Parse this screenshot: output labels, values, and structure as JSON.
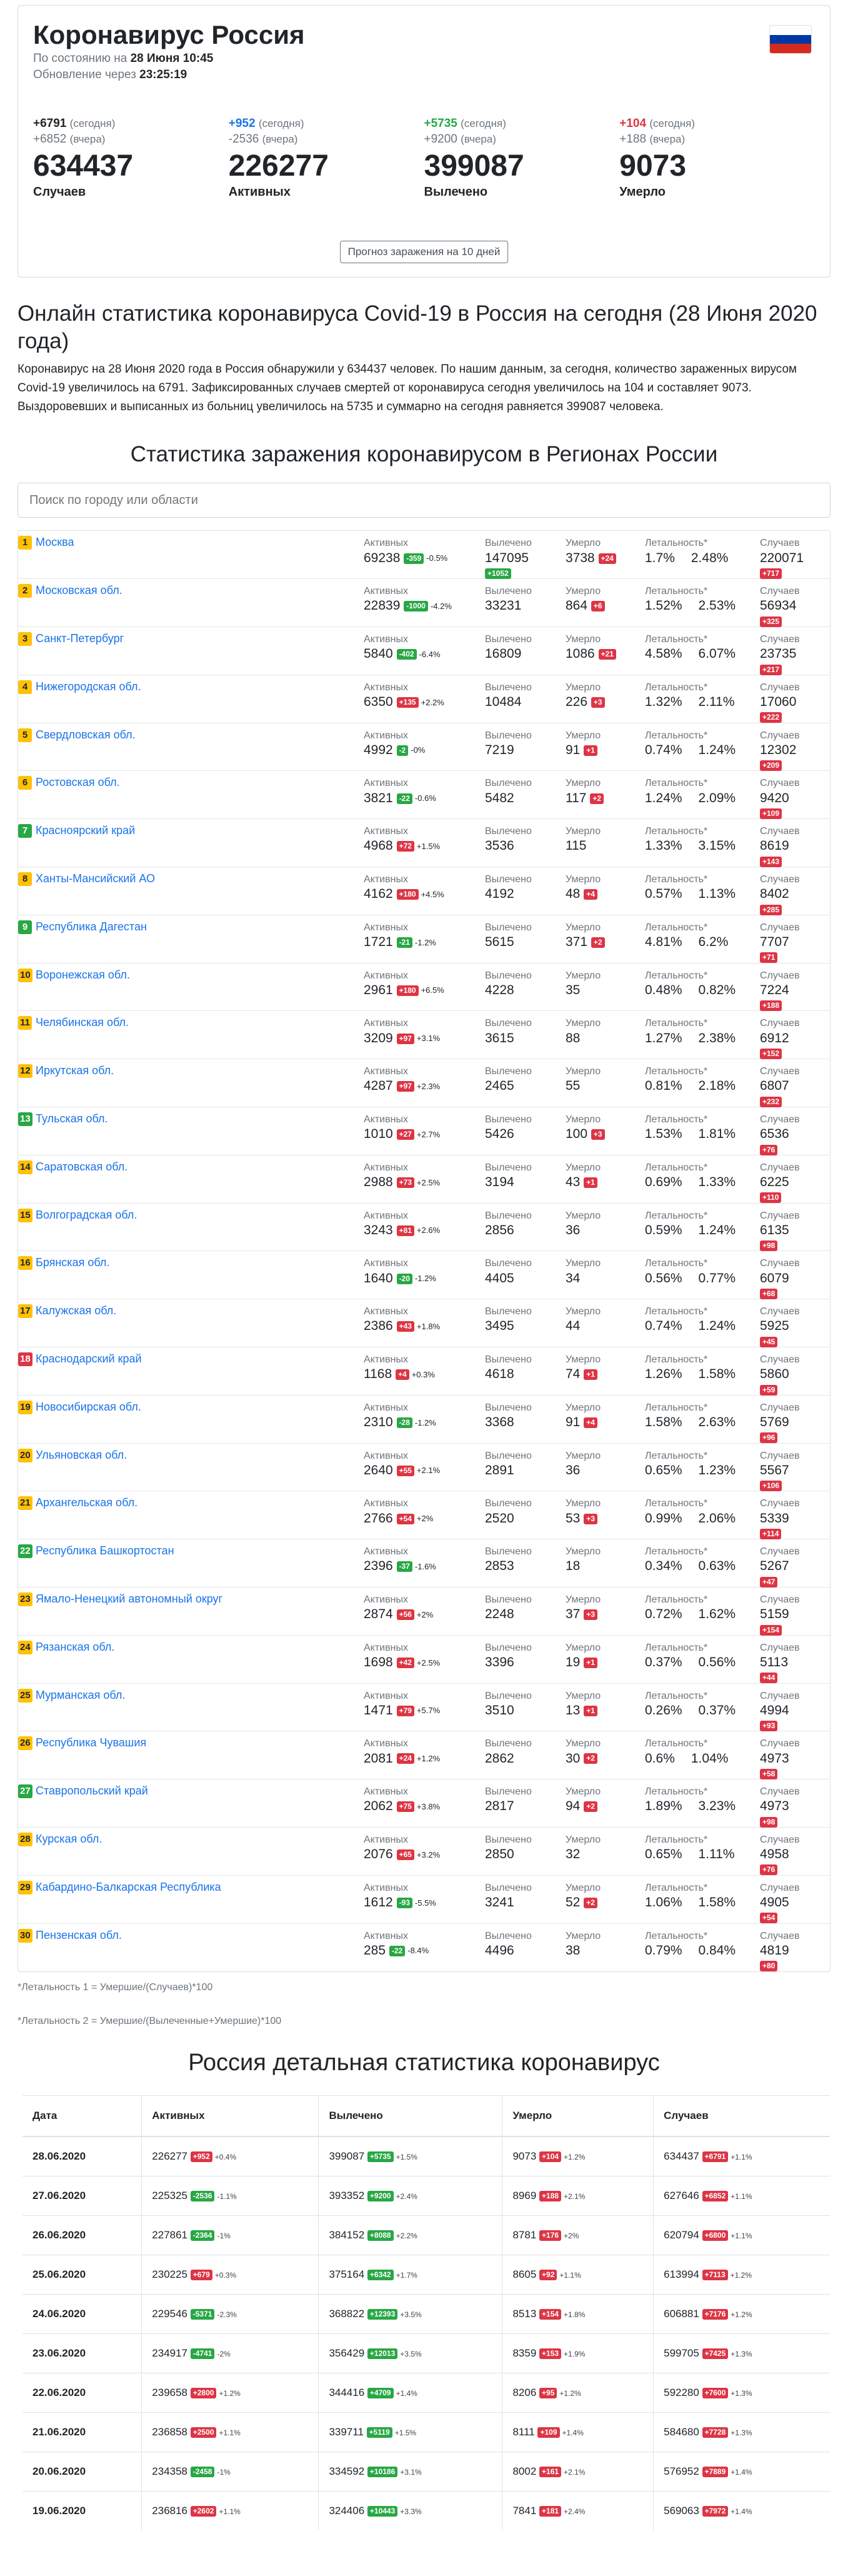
{
  "header": {
    "title": "Коронавирус Россия",
    "as_of_label": "По состоянию на",
    "as_of": "28 Июня 10:45",
    "refresh_label": "Обновление через",
    "refresh_in": "23:25:19"
  },
  "colors": {
    "flag": [
      "#ffffff",
      "#0039a6",
      "#d52b1e"
    ],
    "active": "#1a73e8",
    "recovered": "#28a745",
    "deaths": "#dc3545"
  },
  "stats": [
    {
      "key": "cases",
      "today": "+6791",
      "today_label": "(сегодня)",
      "yesterday": "+6852",
      "yesterday_label": "(вчера)",
      "total": "634437",
      "label": "Случаев",
      "color": "#212529"
    },
    {
      "key": "active",
      "today": "+952",
      "today_label": "(сегодня)",
      "yesterday": "-2536",
      "yesterday_label": "(вчера)",
      "total": "226277",
      "label": "Активных",
      "color": "#1a73e8"
    },
    {
      "key": "recovered",
      "today": "+5735",
      "today_label": "(сегодня)",
      "yesterday": "+9200",
      "yesterday_label": "(вчера)",
      "total": "399087",
      "label": "Вылечено",
      "color": "#28a745"
    },
    {
      "key": "deaths",
      "today": "+104",
      "today_label": "(сегодня)",
      "yesterday": "+188",
      "yesterday_label": "(вчера)",
      "total": "9073",
      "label": "Умерло",
      "color": "#dc3545"
    }
  ],
  "forecast_button": "Прогноз заражения на 10 дней",
  "main_heading": "Онлайн статистика коронавируса Covid-19 в Россия на сегодня (28 Июня 2020 года)",
  "main_text": "Коронавирус на 28 Июня 2020 года в Россия обнаружили у 634437 человек. По нашим данным, за сегодня, количество зараженных вирусом Covid-19 увеличилось на 6791. Зафиксированных случаев смертей от коронавируса сегодня увеличилось на 104 и составляет 9073. Выздоровевших и выписанных из больниц увеличилось на 5735 и суммарно на сегодня равняется 399087 человека.",
  "regions_heading": "Статистика заражения коронавирусом в Регионах России",
  "search_placeholder": "Поиск по городу или области",
  "col_labels": {
    "active": "Активных",
    "recovered": "Вылечено",
    "deaths": "Умерло",
    "lethality": "Летальность*",
    "cases": "Случаев"
  },
  "regions": [
    {
      "n": "1",
      "c": "y",
      "name": "Москва",
      "act": "69238",
      "act_d": "-359",
      "act_p": "-0.5%",
      "rec": "147095",
      "rec_d": "+1052",
      "dead": "3738",
      "dead_d": "+24",
      "l1": "1.7%",
      "l2": "2.48%",
      "cases": "220071",
      "cases_d": "+717"
    },
    {
      "n": "2",
      "c": "y",
      "name": "Московская обл.",
      "act": "22839",
      "act_d": "-1000",
      "act_p": "-4.2%",
      "rec": "33231",
      "rec_d": "+1319",
      "dead": "864",
      "dead_d": "+6",
      "l1": "1.52%",
      "l2": "2.53%",
      "cases": "56934",
      "cases_d": "+325"
    },
    {
      "n": "3",
      "c": "y",
      "name": "Санкт-Петербург",
      "act": "5840",
      "act_d": "-402",
      "act_p": "-6.4%",
      "rec": "16809",
      "rec_d": "+598",
      "dead": "1086",
      "dead_d": "+21",
      "l1": "4.58%",
      "l2": "6.07%",
      "cases": "23735",
      "cases_d": "+217"
    },
    {
      "n": "4",
      "c": "y",
      "name": "Нижегородская обл.",
      "act": "6350",
      "act_d": "+135",
      "act_p": "+2.2%",
      "rec": "10484",
      "rec_d": "+84",
      "dead": "226",
      "dead_d": "+3",
      "l1": "1.32%",
      "l2": "2.11%",
      "cases": "17060",
      "cases_d": "+222"
    },
    {
      "n": "5",
      "c": "y",
      "name": "Свердловская обл.",
      "act": "4992",
      "act_d": "-2",
      "act_p": "-0%",
      "rec": "7219",
      "rec_d": "+210",
      "dead": "91",
      "dead_d": "+1",
      "l1": "0.74%",
      "l2": "1.24%",
      "cases": "12302",
      "cases_d": "+209"
    },
    {
      "n": "6",
      "c": "y",
      "name": "Ростовская обл.",
      "act": "3821",
      "act_d": "-22",
      "act_p": "-0.6%",
      "rec": "5482",
      "rec_d": "+129",
      "dead": "117",
      "dead_d": "+2",
      "l1": "1.24%",
      "l2": "2.09%",
      "cases": "9420",
      "cases_d": "+109"
    },
    {
      "n": "7",
      "c": "g",
      "name": "Красноярский край",
      "act": "4968",
      "act_d": "+72",
      "act_p": "+1.5%",
      "rec": "3536",
      "rec_d": "+71",
      "dead": "115",
      "dead_d": "",
      "l1": "1.33%",
      "l2": "3.15%",
      "cases": "8619",
      "cases_d": "+143"
    },
    {
      "n": "8",
      "c": "y",
      "name": "Ханты-Мансийский АО",
      "act": "4162",
      "act_d": "+180",
      "act_p": "+4.5%",
      "rec": "4192",
      "rec_d": "+101",
      "dead": "48",
      "dead_d": "+4",
      "l1": "0.57%",
      "l2": "1.13%",
      "cases": "8402",
      "cases_d": "+285"
    },
    {
      "n": "9",
      "c": "g",
      "name": "Республика Дагестан",
      "act": "1721",
      "act_d": "-21",
      "act_p": "-1.2%",
      "rec": "5615",
      "rec_d": "+90",
      "dead": "371",
      "dead_d": "+2",
      "l1": "4.81%",
      "l2": "6.2%",
      "cases": "7707",
      "cases_d": "+71"
    },
    {
      "n": "10",
      "c": "y",
      "name": "Воронежская обл.",
      "act": "2961",
      "act_d": "+180",
      "act_p": "+6.5%",
      "rec": "4228",
      "rec_d": "+8",
      "dead": "35",
      "dead_d": "",
      "l1": "0.48%",
      "l2": "0.82%",
      "cases": "7224",
      "cases_d": "+188"
    },
    {
      "n": "11",
      "c": "y",
      "name": "Челябинская обл.",
      "act": "3209",
      "act_d": "+97",
      "act_p": "+3.1%",
      "rec": "3615",
      "rec_d": "+55",
      "dead": "88",
      "dead_d": "",
      "l1": "1.27%",
      "l2": "2.38%",
      "cases": "6912",
      "cases_d": "+152"
    },
    {
      "n": "12",
      "c": "y",
      "name": "Иркутская обл.",
      "act": "4287",
      "act_d": "+97",
      "act_p": "+2.3%",
      "rec": "2465",
      "rec_d": "+135",
      "dead": "55",
      "dead_d": "",
      "l1": "0.81%",
      "l2": "2.18%",
      "cases": "6807",
      "cases_d": "+232"
    },
    {
      "n": "13",
      "c": "g",
      "name": "Тульская обл.",
      "act": "1010",
      "act_d": "+27",
      "act_p": "+2.7%",
      "rec": "5426",
      "rec_d": "+46",
      "dead": "100",
      "dead_d": "+3",
      "l1": "1.53%",
      "l2": "1.81%",
      "cases": "6536",
      "cases_d": "+76"
    },
    {
      "n": "14",
      "c": "y",
      "name": "Саратовская обл.",
      "act": "2988",
      "act_d": "+73",
      "act_p": "+2.5%",
      "rec": "3194",
      "rec_d": "+36",
      "dead": "43",
      "dead_d": "+1",
      "l1": "0.69%",
      "l2": "1.33%",
      "cases": "6225",
      "cases_d": "+110"
    },
    {
      "n": "15",
      "c": "y",
      "name": "Волгоградская обл.",
      "act": "3243",
      "act_d": "+81",
      "act_p": "+2.6%",
      "rec": "2856",
      "rec_d": "+17",
      "dead": "36",
      "dead_d": "",
      "l1": "0.59%",
      "l2": "1.24%",
      "cases": "6135",
      "cases_d": "+98"
    },
    {
      "n": "16",
      "c": "y",
      "name": "Брянская обл.",
      "act": "1640",
      "act_d": "-20",
      "act_p": "-1.2%",
      "rec": "4405",
      "rec_d": "+48",
      "dead": "34",
      "dead_d": "",
      "l1": "0.56%",
      "l2": "0.77%",
      "cases": "6079",
      "cases_d": "+68"
    },
    {
      "n": "17",
      "c": "y",
      "name": "Калужская обл.",
      "act": "2386",
      "act_d": "+43",
      "act_p": "+1.8%",
      "rec": "3495",
      "rec_d": "+2",
      "dead": "44",
      "dead_d": "",
      "l1": "0.74%",
      "l2": "1.24%",
      "cases": "5925",
      "cases_d": "+45"
    },
    {
      "n": "18",
      "c": "r",
      "name": "Краснодарский край",
      "act": "1168",
      "act_d": "+4",
      "act_p": "+0.3%",
      "rec": "4618",
      "rec_d": "+54",
      "dead": "74",
      "dead_d": "+1",
      "l1": "1.26%",
      "l2": "1.58%",
      "cases": "5860",
      "cases_d": "+59"
    },
    {
      "n": "19",
      "c": "y",
      "name": "Новосибирская обл.",
      "act": "2310",
      "act_d": "-28",
      "act_p": "-1.2%",
      "rec": "3368",
      "rec_d": "+66",
      "dead": "91",
      "dead_d": "+4",
      "l1": "1.58%",
      "l2": "2.63%",
      "cases": "5769",
      "cases_d": "+96"
    },
    {
      "n": "20",
      "c": "y",
      "name": "Ульяновская обл.",
      "act": "2640",
      "act_d": "+55",
      "act_p": "+2.1%",
      "rec": "2891",
      "rec_d": "+51",
      "dead": "36",
      "dead_d": "",
      "l1": "0.65%",
      "l2": "1.23%",
      "cases": "5567",
      "cases_d": "+106"
    },
    {
      "n": "21",
      "c": "y",
      "name": "Архангельская обл.",
      "act": "2766",
      "act_d": "+54",
      "act_p": "+2%",
      "rec": "2520",
      "rec_d": "+57",
      "dead": "53",
      "dead_d": "+3",
      "l1": "0.99%",
      "l2": "2.06%",
      "cases": "5339",
      "cases_d": "+114"
    },
    {
      "n": "22",
      "c": "g",
      "name": "Республика Башкортостан",
      "act": "2396",
      "act_d": "-37",
      "act_p": "-1.6%",
      "rec": "2853",
      "rec_d": "+84",
      "dead": "18",
      "dead_d": "",
      "l1": "0.34%",
      "l2": "0.63%",
      "cases": "5267",
      "cases_d": "+47"
    },
    {
      "n": "23",
      "c": "y",
      "name": "Ямало-Ненецкий автономный округ",
      "act": "2874",
      "act_d": "+56",
      "act_p": "+2%",
      "rec": "2248",
      "rec_d": "+95",
      "dead": "37",
      "dead_d": "+3",
      "l1": "0.72%",
      "l2": "1.62%",
      "cases": "5159",
      "cases_d": "+154"
    },
    {
      "n": "24",
      "c": "y",
      "name": "Рязанская обл.",
      "act": "1698",
      "act_d": "+42",
      "act_p": "+2.5%",
      "rec": "3396",
      "rec_d": "+1",
      "dead": "19",
      "dead_d": "+1",
      "l1": "0.37%",
      "l2": "0.56%",
      "cases": "5113",
      "cases_d": "+44"
    },
    {
      "n": "25",
      "c": "y",
      "name": "Мурманская обл.",
      "act": "1471",
      "act_d": "+79",
      "act_p": "+5.7%",
      "rec": "3510",
      "rec_d": "+13",
      "dead": "13",
      "dead_d": "+1",
      "l1": "0.26%",
      "l2": "0.37%",
      "cases": "4994",
      "cases_d": "+93"
    },
    {
      "n": "26",
      "c": "y",
      "name": "Республика Чувашия",
      "act": "2081",
      "act_d": "+24",
      "act_p": "+1.2%",
      "rec": "2862",
      "rec_d": "+32",
      "dead": "30",
      "dead_d": "+2",
      "l1": "0.6%",
      "l2": "1.04%",
      "cases": "4973",
      "cases_d": "+58"
    },
    {
      "n": "27",
      "c": "g",
      "name": "Ставропольский край",
      "act": "2062",
      "act_d": "+75",
      "act_p": "+3.8%",
      "rec": "2817",
      "rec_d": "+21",
      "dead": "94",
      "dead_d": "+2",
      "l1": "1.89%",
      "l2": "3.23%",
      "cases": "4973",
      "cases_d": "+98"
    },
    {
      "n": "28",
      "c": "y",
      "name": "Курская обл.",
      "act": "2076",
      "act_d": "+65",
      "act_p": "+3.2%",
      "rec": "2850",
      "rec_d": "+11",
      "dead": "32",
      "dead_d": "",
      "l1": "0.65%",
      "l2": "1.11%",
      "cases": "4958",
      "cases_d": "+76"
    },
    {
      "n": "29",
      "c": "y",
      "name": "Кабардино-Балкарская Республика",
      "act": "1612",
      "act_d": "-93",
      "act_p": "-5.5%",
      "rec": "3241",
      "rec_d": "+145",
      "dead": "52",
      "dead_d": "+2",
      "l1": "1.06%",
      "l2": "1.58%",
      "cases": "4905",
      "cases_d": "+54"
    },
    {
      "n": "30",
      "c": "y",
      "name": "Пензенская обл.",
      "act": "285",
      "act_d": "-22",
      "act_p": "-8.4%",
      "rec": "4496",
      "rec_d": "+58",
      "dead": "38",
      "dead_d": "",
      "l1": "0.79%",
      "l2": "0.84%",
      "cases": "4819",
      "cases_d": "+80"
    }
  ],
  "notes": [
    "*Летальность 1 = Умершие/(Случаев)*100",
    "*Летальность 2 = Умершие/(Вылеченные+Умершие)*100"
  ],
  "history_heading": "Россия детальная статистика коронавирус",
  "history_headers": [
    "Дата",
    "Активных",
    "Вылечено",
    "Умерло",
    "Случаев"
  ],
  "history": [
    {
      "date": "28.06.2020",
      "act": "226277",
      "act_d": "+952",
      "act_p": "+0.4%",
      "rec": "399087",
      "rec_d": "+5735",
      "rec_p": "+1.5%",
      "dead": "9073",
      "dead_d": "+104",
      "dead_p": "+1.2%",
      "cases": "634437",
      "cases_d": "+6791",
      "cases_p": "+1.1%"
    },
    {
      "date": "27.06.2020",
      "act": "225325",
      "act_d": "-2536",
      "act_p": "-1.1%",
      "rec": "393352",
      "rec_d": "+9200",
      "rec_p": "+2.4%",
      "dead": "8969",
      "dead_d": "+188",
      "dead_p": "+2.1%",
      "cases": "627646",
      "cases_d": "+6852",
      "cases_p": "+1.1%"
    },
    {
      "date": "26.06.2020",
      "act": "227861",
      "act_d": "-2364",
      "act_p": "-1%",
      "rec": "384152",
      "rec_d": "+8088",
      "rec_p": "+2.2%",
      "dead": "8781",
      "dead_d": "+176",
      "dead_p": "+2%",
      "cases": "620794",
      "cases_d": "+6800",
      "cases_p": "+1.1%"
    },
    {
      "date": "25.06.2020",
      "act": "230225",
      "act_d": "+679",
      "act_p": "+0.3%",
      "rec": "375164",
      "rec_d": "+6342",
      "rec_p": "+1.7%",
      "dead": "8605",
      "dead_d": "+92",
      "dead_p": "+1.1%",
      "cases": "613994",
      "cases_d": "+7113",
      "cases_p": "+1.2%"
    },
    {
      "date": "24.06.2020",
      "act": "229546",
      "act_d": "-5371",
      "act_p": "-2.3%",
      "rec": "368822",
      "rec_d": "+12393",
      "rec_p": "+3.5%",
      "dead": "8513",
      "dead_d": "+154",
      "dead_p": "+1.8%",
      "cases": "606881",
      "cases_d": "+7176",
      "cases_p": "+1.2%"
    },
    {
      "date": "23.06.2020",
      "act": "234917",
      "act_d": "-4741",
      "act_p": "-2%",
      "rec": "356429",
      "rec_d": "+12013",
      "rec_p": "+3.5%",
      "dead": "8359",
      "dead_d": "+153",
      "dead_p": "+1.9%",
      "cases": "599705",
      "cases_d": "+7425",
      "cases_p": "+1.3%"
    },
    {
      "date": "22.06.2020",
      "act": "239658",
      "act_d": "+2800",
      "act_p": "+1.2%",
      "rec": "344416",
      "rec_d": "+4709",
      "rec_p": "+1.4%",
      "dead": "8206",
      "dead_d": "+95",
      "dead_p": "+1.2%",
      "cases": "592280",
      "cases_d": "+7600",
      "cases_p": "+1.3%"
    },
    {
      "date": "21.06.2020",
      "act": "236858",
      "act_d": "+2500",
      "act_p": "+1.1%",
      "rec": "339711",
      "rec_d": "+5119",
      "rec_p": "+1.5%",
      "dead": "8111",
      "dead_d": "+109",
      "dead_p": "+1.4%",
      "cases": "584680",
      "cases_d": "+7728",
      "cases_p": "+1.3%"
    },
    {
      "date": "20.06.2020",
      "act": "234358",
      "act_d": "-2458",
      "act_p": "-1%",
      "rec": "334592",
      "rec_d": "+10186",
      "rec_p": "+3.1%",
      "dead": "8002",
      "dead_d": "+161",
      "dead_p": "+2.1%",
      "cases": "576952",
      "cases_d": "+7889",
      "cases_p": "+1.4%"
    },
    {
      "date": "19.06.2020",
      "act": "236816",
      "act_d": "+2602",
      "act_p": "+1.1%",
      "rec": "324406",
      "rec_d": "+10443",
      "rec_p": "+3.3%",
      "dead": "7841",
      "dead_d": "+181",
      "dead_p": "+2.4%",
      "cases": "569063",
      "cases_d": "+7972",
      "cases_p": "+1.4%"
    }
  ]
}
